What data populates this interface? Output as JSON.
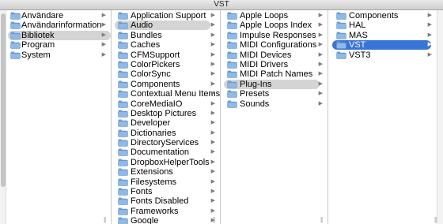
{
  "window": {
    "title": "VST"
  },
  "columns": [
    {
      "items": [
        {
          "label": "Användare",
          "has_children": true,
          "selected": ""
        },
        {
          "label": "Användarinformation",
          "has_children": true,
          "selected": ""
        },
        {
          "label": "Bibliotek",
          "has_children": true,
          "selected": "gray"
        },
        {
          "label": "Program",
          "has_children": true,
          "selected": ""
        },
        {
          "label": "System",
          "has_children": true,
          "selected": ""
        }
      ]
    },
    {
      "items": [
        {
          "label": "Application Support",
          "has_children": true,
          "selected": ""
        },
        {
          "label": "Audio",
          "has_children": true,
          "selected": "gray"
        },
        {
          "label": "Bundles",
          "has_children": true,
          "selected": ""
        },
        {
          "label": "Caches",
          "has_children": true,
          "selected": ""
        },
        {
          "label": "CFMSupport",
          "has_children": true,
          "selected": ""
        },
        {
          "label": "ColorPickers",
          "has_children": true,
          "selected": ""
        },
        {
          "label": "ColorSync",
          "has_children": true,
          "selected": ""
        },
        {
          "label": "Components",
          "has_children": true,
          "selected": ""
        },
        {
          "label": "Contextual Menu Items",
          "has_children": true,
          "selected": ""
        },
        {
          "label": "CoreMediaIO",
          "has_children": true,
          "selected": ""
        },
        {
          "label": "Desktop Pictures",
          "has_children": true,
          "selected": ""
        },
        {
          "label": "Developer",
          "has_children": true,
          "selected": ""
        },
        {
          "label": "Dictionaries",
          "has_children": true,
          "selected": ""
        },
        {
          "label": "DirectoryServices",
          "has_children": true,
          "selected": ""
        },
        {
          "label": "Documentation",
          "has_children": true,
          "selected": ""
        },
        {
          "label": "DropboxHelperTools",
          "has_children": true,
          "selected": ""
        },
        {
          "label": "Extensions",
          "has_children": true,
          "selected": ""
        },
        {
          "label": "Filesystems",
          "has_children": true,
          "selected": ""
        },
        {
          "label": "Fonts",
          "has_children": true,
          "selected": ""
        },
        {
          "label": "Fonts Disabled",
          "has_children": true,
          "selected": ""
        },
        {
          "label": "Frameworks",
          "has_children": true,
          "selected": ""
        },
        {
          "label": "Google",
          "has_children": true,
          "selected": ""
        }
      ]
    },
    {
      "items": [
        {
          "label": "Apple Loops",
          "has_children": true,
          "selected": ""
        },
        {
          "label": "Apple Loops Index",
          "has_children": true,
          "selected": ""
        },
        {
          "label": "Impulse Responses",
          "has_children": true,
          "selected": ""
        },
        {
          "label": "MIDI Configurations",
          "has_children": true,
          "selected": ""
        },
        {
          "label": "MIDI Devices",
          "has_children": true,
          "selected": ""
        },
        {
          "label": "MIDI Drivers",
          "has_children": true,
          "selected": ""
        },
        {
          "label": "MIDI Patch Names",
          "has_children": true,
          "selected": ""
        },
        {
          "label": "Plug-Ins",
          "has_children": true,
          "selected": "gray"
        },
        {
          "label": "Presets",
          "has_children": true,
          "selected": ""
        },
        {
          "label": "Sounds",
          "has_children": true,
          "selected": ""
        }
      ]
    },
    {
      "items": [
        {
          "label": "Components",
          "has_children": true,
          "selected": ""
        },
        {
          "label": "HAL",
          "has_children": true,
          "selected": ""
        },
        {
          "label": "MAS",
          "has_children": true,
          "selected": ""
        },
        {
          "label": "VST",
          "has_children": true,
          "selected": "blue"
        },
        {
          "label": "VST3",
          "has_children": true,
          "selected": ""
        }
      ]
    }
  ],
  "icons": {
    "folder": "folder-icon",
    "disclosure": "disclosure-arrow-icon"
  },
  "colors": {
    "selection_active": "#3975d6",
    "selection_inactive": "#d4d4d4",
    "folder_body": "#8fb9e6",
    "folder_tab": "#6fa0d6"
  }
}
